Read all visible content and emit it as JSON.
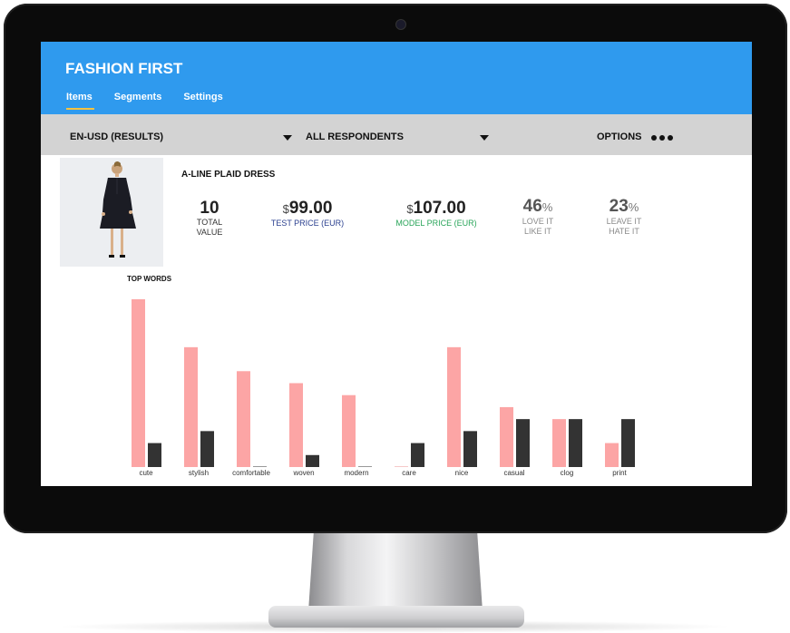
{
  "app": {
    "title": "FASHION FIRST",
    "tabs": [
      {
        "label": "Items",
        "active": true
      },
      {
        "label": "Segments",
        "active": false
      },
      {
        "label": "Settings",
        "active": false
      }
    ]
  },
  "filters": {
    "locale": "EN-USD (RESULTS)",
    "audience": "ALL RESPONDENTS",
    "options_label": "OPTIONS"
  },
  "product": {
    "name": "A-LINE PLAID DRESS",
    "total_value": "10",
    "total_value_label_1": "TOTAL",
    "total_value_label_2": "VALUE",
    "test_price_currency": "$",
    "test_price": "99.00",
    "test_price_label": "TEST PRICE (EUR)",
    "model_price_currency": "$",
    "model_price": "107.00",
    "model_price_label": "MODEL PRICE (EUR)",
    "love_pct": "46",
    "love_pct_sign": "%",
    "love_label_1": "LOVE IT",
    "love_label_2": "LIKE IT",
    "leave_pct": "23",
    "leave_pct_sign": "%",
    "leave_label_1": "LEAVE IT",
    "leave_label_2": "HATE IT"
  },
  "top_words_label": "TOP WORDS",
  "colors": {
    "header_blue": "#2f9aee",
    "filter_grey": "#d3d3d3",
    "bar_pink": "#fca5a5",
    "bar_dark": "#333333",
    "tab_underline": "#f5c242"
  },
  "chart_data": {
    "type": "bar",
    "categories": [
      "cute",
      "stylish",
      "comfortable",
      "woven",
      "modern",
      "care",
      "nice",
      "casual",
      "clog",
      "print"
    ],
    "series": [
      {
        "values": [
          14,
          10,
          8,
          7,
          6,
          0,
          10,
          5,
          4,
          2
        ]
      },
      {
        "values": [
          2,
          3,
          0,
          1,
          0,
          2,
          3,
          4,
          4,
          4
        ]
      }
    ],
    "ylim": [
      0,
      14
    ],
    "grid": false,
    "legend": "none"
  }
}
